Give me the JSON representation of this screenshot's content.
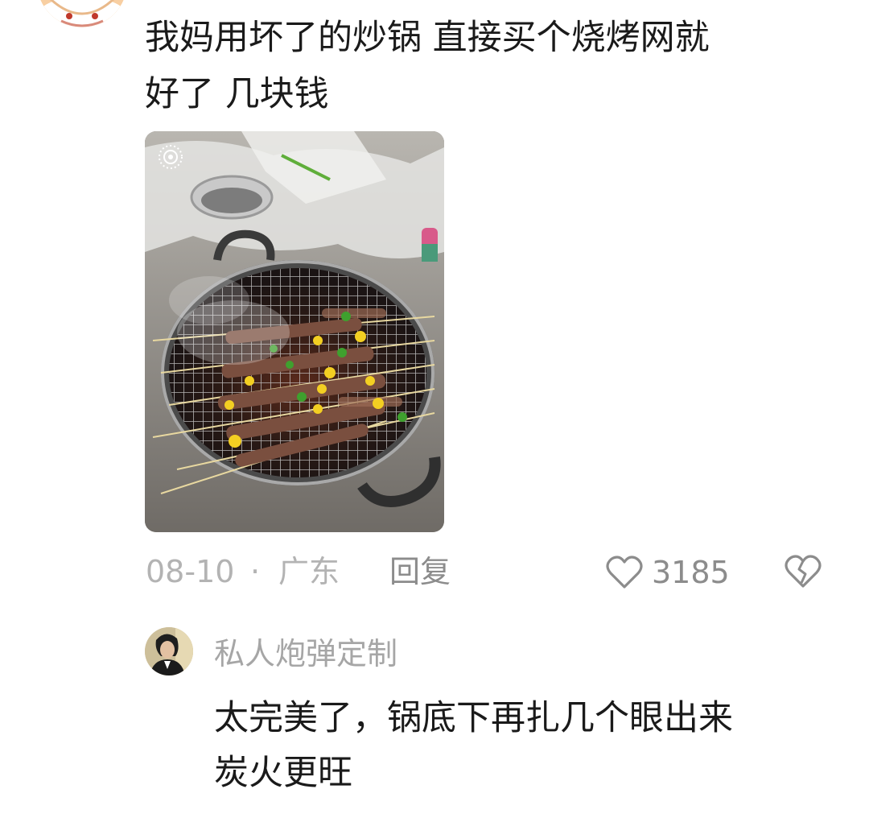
{
  "comment": {
    "avatar_icon": "cartoon-face-avatar",
    "text": "我妈用坏了的炒锅 直接买个烧烤网就\n好了 几块钱",
    "image_icon": "bbq-grill-photo",
    "date": "08-10",
    "separator": "·",
    "location": "广东",
    "reply_label": "回复",
    "like_icon": "heart-outline-icon",
    "like_count": "3185",
    "dislike_icon": "broken-heart-icon"
  },
  "reply": {
    "avatar_icon": "user-avatar",
    "username": "私人炮弹定制",
    "text": "太完美了，锅底下再扎几个眼出来\n炭火更旺"
  },
  "colors": {
    "text_primary": "#1a1a1a",
    "text_secondary": "#b3b3b3",
    "icon_gray": "#8c8c8c"
  }
}
